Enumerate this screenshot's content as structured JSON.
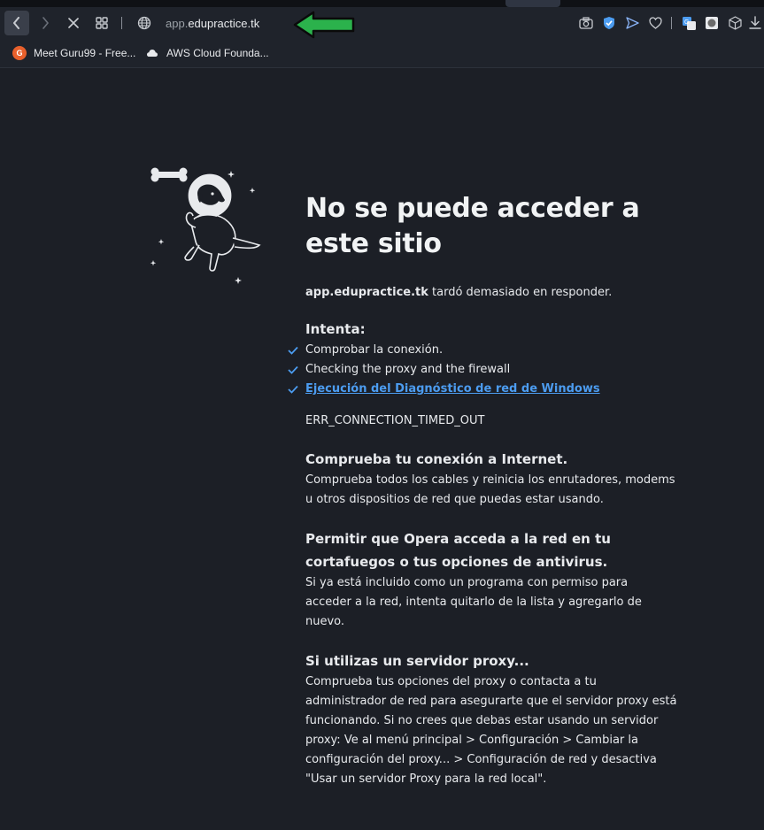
{
  "browser": {
    "url_prefix": "app.",
    "url_domain": "edupractice.tk",
    "icons": {
      "back": "back-arrow-icon",
      "forward": "forward-arrow-icon",
      "stop": "close-icon",
      "tabs": "grid-icon",
      "site_info": "globe-icon",
      "snapshot": "camera-icon",
      "vpn": "shield-icon",
      "send": "send-icon",
      "heart": "heart-icon",
      "translate": "translate-icon",
      "extension": "record-icon",
      "cube": "cube-icon",
      "download": "download-icon"
    },
    "annotation_arrow_color": "#2bb24c"
  },
  "bookmarks": [
    {
      "label": "Meet Guru99 - Free...",
      "icon": "guru99-logo"
    },
    {
      "label": "AWS Cloud Founda...",
      "icon": "cloud-icon"
    }
  ],
  "error_page": {
    "title": "No se puede acceder a este sitio",
    "host": "app.edupractice.tk",
    "host_suffix": " tardó demasiado en responder.",
    "try_heading": "Intenta:",
    "suggestions": [
      "Comprobar la conexión.",
      "Checking the proxy and the firewall"
    ],
    "diagnostics_link": "Ejecución del Diagnóstico de red de Windows",
    "error_code": "ERR_CONNECTION_TIMED_OUT",
    "sections": [
      {
        "title": "Comprueba tu conexión a Internet.",
        "body": "Comprueba todos los cables y reinicia los enrutadores, modems u otros dispositios de red que puedas estar usando."
      },
      {
        "title": "Permitir que Opera acceda a la red en tu cortafuegos o tus opciones de antivirus.",
        "body": "Si ya está incluido como un programa con permiso para acceder a la red, intenta quitarlo de la lista y agregarlo de nuevo."
      },
      {
        "title": "Si utilizas un servidor proxy...",
        "body": "Comprueba tus opciones del proxy o contacta a tu administrador de red para asegurarte que el servidor proxy está funcionando. Si no crees que debas estar usando un servidor proxy: Ve al menú principal > Configuración > Cambiar la configuración del proxy... > Configuración de red y desactiva \"Usar un servidor Proxy para la red local\"."
      }
    ],
    "illustration": "astronaut-dog-illustration",
    "accent_color": "#4c9cf0"
  }
}
